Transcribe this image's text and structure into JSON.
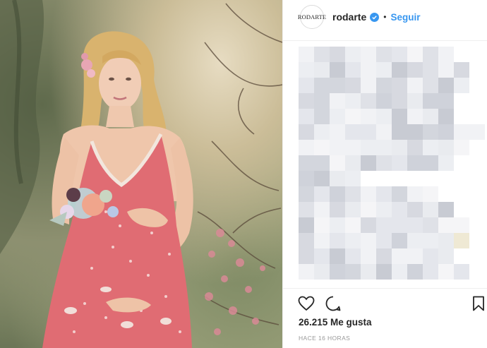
{
  "header": {
    "avatar_text": "RODARTE",
    "username": "rodarte",
    "separator": "•",
    "follow_label": "Seguir"
  },
  "photo": {
    "subject": "woman in pink embroidered gown holding flower corsage"
  },
  "comments": {
    "state": "pixelated"
  },
  "actions": {
    "like_icon": "heart-icon",
    "comment_icon": "comment-icon",
    "save_icon": "bookmark-icon"
  },
  "likes_text": "26.215 Me gusta",
  "timestamp": "HACE 16 HORAS",
  "colors": {
    "link": "#3897f0",
    "verified": "#3897f0",
    "text": "#262626",
    "muted": "#999999",
    "dress": "#e06c73"
  }
}
